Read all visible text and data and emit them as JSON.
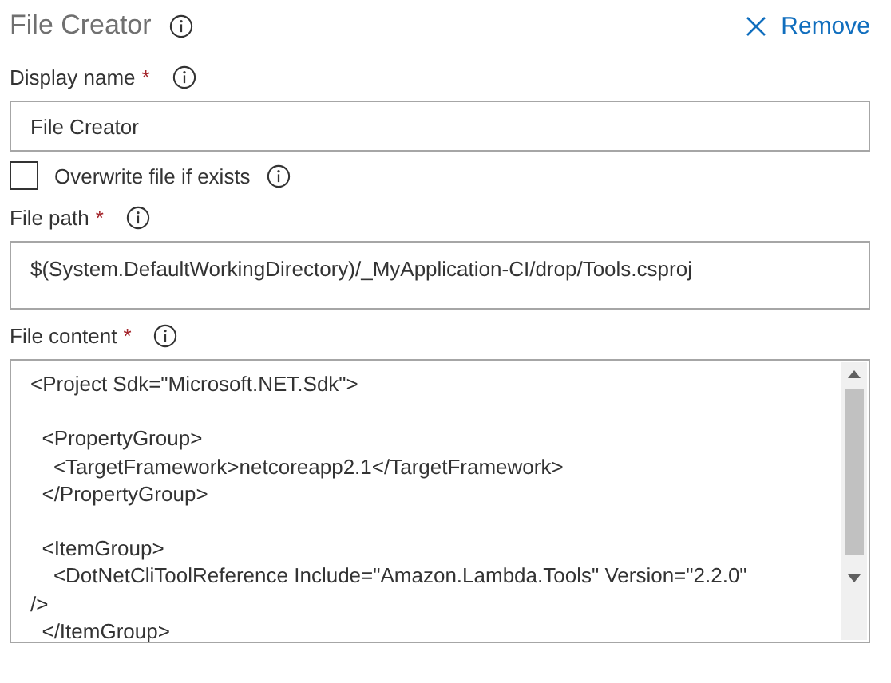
{
  "header": {
    "title": "File Creator",
    "remove_label": "Remove"
  },
  "fields": [
    {
      "kind": "text",
      "label": "Display name",
      "required_mark": "*",
      "value": "File Creator"
    },
    {
      "kind": "checkbox",
      "label": "Overwrite file if exists",
      "checked": false
    },
    {
      "kind": "path",
      "label": "File path",
      "required_mark": "*",
      "value": "$(System.DefaultWorkingDirectory)/_MyApplication-CI/drop/Tools.csproj"
    },
    {
      "kind": "code",
      "label": "File content",
      "required_mark": "*",
      "blocks": [
        [
          "<Project Sdk=\"Microsoft.NET.Sdk\">"
        ],
        [
          "  <PropertyGroup>",
          "    <TargetFramework>netcoreapp2.1</TargetFramework>",
          "  </PropertyGroup>"
        ],
        [
          "  <ItemGroup>",
          "    <DotNetCliToolReference Include=\"Amazon.Lambda.Tools\" Version=\"2.2.0\"",
          "/>",
          "  </ItemGroup>"
        ]
      ]
    }
  ]
}
